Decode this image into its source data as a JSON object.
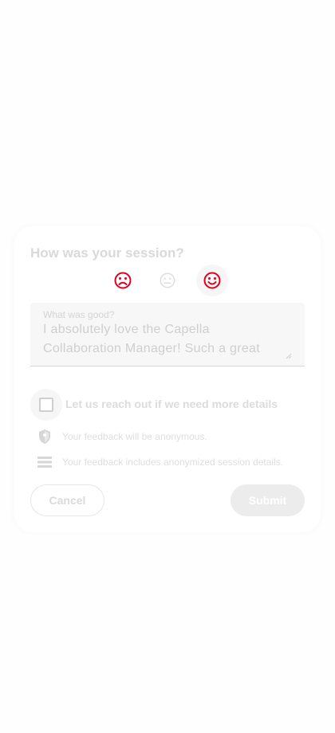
{
  "dialog": {
    "title": "How was your session?",
    "rating": {
      "options": [
        {
          "name": "frown-icon",
          "label": "bad"
        },
        {
          "name": "neutral-face-icon",
          "label": "neutral"
        },
        {
          "name": "smile-icon",
          "label": "good"
        }
      ],
      "selected": "good",
      "accent_color": "#e0001b",
      "inactive_color": "#dedede"
    },
    "feedback_field": {
      "label": "What was good?",
      "value": "I absolutely love the Capella Collaboration Manager! Such a great"
    },
    "contact_checkbox": {
      "label": "Let us reach out if we need more details",
      "checked": false
    },
    "info": [
      {
        "icon": "shield-icon",
        "text": "Your feedback will be anonymous."
      },
      {
        "icon": "list-icon",
        "text": "Your feedback includes anonymized session details."
      }
    ],
    "buttons": {
      "cancel_label": "Cancel",
      "submit_label": "Submit"
    }
  }
}
